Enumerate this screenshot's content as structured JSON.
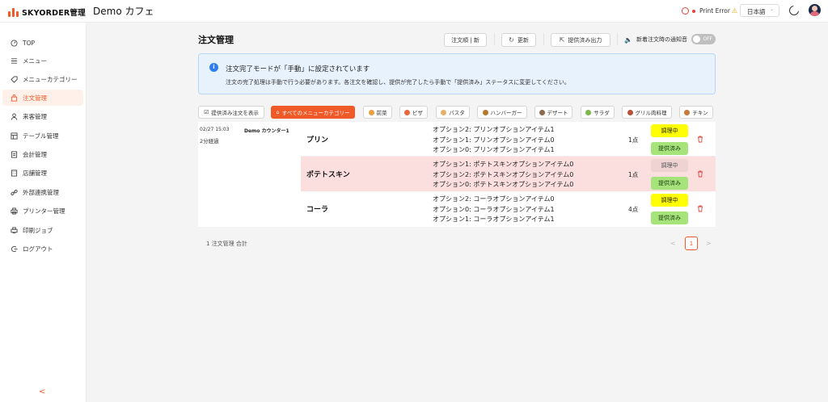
{
  "app": {
    "logo_text": "SKYORDER管理",
    "shop_name": "Demo カフェ"
  },
  "header": {
    "printer_status": "Print Error",
    "warning_glyph": "⚠",
    "language": "日本語"
  },
  "sidebar": {
    "items": [
      {
        "label": "TOP",
        "icon": "dashboard-icon"
      },
      {
        "label": "メニュー",
        "icon": "list-icon"
      },
      {
        "label": "メニューカテゴリー",
        "icon": "tag-icon"
      },
      {
        "label": "注文管理",
        "icon": "bag-icon",
        "active": true
      },
      {
        "label": "来客管理",
        "icon": "user-icon"
      },
      {
        "label": "テーブル管理",
        "icon": "table-icon"
      },
      {
        "label": "会計管理",
        "icon": "invoice-icon"
      },
      {
        "label": "店舗管理",
        "icon": "store-icon"
      },
      {
        "label": "外部連携管理",
        "icon": "link-icon"
      },
      {
        "label": "プリンター管理",
        "icon": "printer-icon"
      },
      {
        "label": "印刷ジョブ",
        "icon": "print-job-icon"
      },
      {
        "label": "ログアウト",
        "icon": "logout-icon"
      }
    ],
    "collapse_glyph": "<"
  },
  "main": {
    "title": "注文管理",
    "toolbar": {
      "order_sort": "注文順 | 新",
      "refresh": "更新",
      "export": "提供済み出力",
      "notify_label": "新着注文時の通知音",
      "toggle_text": "OFF"
    },
    "alert": {
      "title": "注文完了モードが「手動」に設定されています",
      "description": "注文の完了処理は手動で行う必要があります。各注文を確認し、提供が完了したら手動で「提供済み」ステータスに変更してください。"
    },
    "filters": [
      {
        "label": "提供済み注文を表示",
        "color": ""
      },
      {
        "label": "すべてのメニューカテゴリー",
        "color": "",
        "active": true
      },
      {
        "label": "前菜",
        "color": "#e9a040"
      },
      {
        "label": "ピザ",
        "color": "#e8683b"
      },
      {
        "label": "パスタ",
        "color": "#e2b26a"
      },
      {
        "label": "ハンバーガー",
        "color": "#b5782e"
      },
      {
        "label": "デザート",
        "color": "#8c6a4d"
      },
      {
        "label": "サラダ",
        "color": "#7db64a"
      },
      {
        "label": "グリル肉料理",
        "color": "#b4533a"
      },
      {
        "label": "チキン",
        "color": "#c87a3a"
      }
    ],
    "order": {
      "time": "02/27 15:03",
      "table": "Demo カウンター1",
      "elapsed": "2分経過",
      "items": [
        {
          "name": "プリン",
          "options": [
            "オプション2: プリンオプションアイテム1",
            "オプション1: プリンオプションアイテム0",
            "オプション0: プリンオプションアイテム1"
          ],
          "qty": "1点",
          "status": "調理中",
          "served": "提供済み"
        },
        {
          "name": "ポテトスキン",
          "options": [
            "オプション1: ポテトスキンオプションアイテム0",
            "オプション2: ポテトスキンオプションアイテム0",
            "オプション0: ポテトスキンオプションアイテム0"
          ],
          "qty": "1点",
          "status": "調理中",
          "served": "提供済み"
        },
        {
          "name": "コーラ",
          "options": [
            "オプション2: コーラオプションアイテム0",
            "オプション0: コーラオプションアイテム1",
            "オプション1: コーラオプションアイテム1"
          ],
          "qty": "4点",
          "status": "調理中",
          "served": "提供済み"
        }
      ]
    },
    "summary": "1 注文管理 合計",
    "pagination": {
      "prev": "<",
      "current": "1",
      "next": ">"
    }
  },
  "colors": {
    "accent": "#f05a28",
    "cooking": "#ffff00",
    "served": "#a6e37a",
    "highlight_row": "#fbdfdf",
    "info_bg": "#e8f2fd"
  }
}
